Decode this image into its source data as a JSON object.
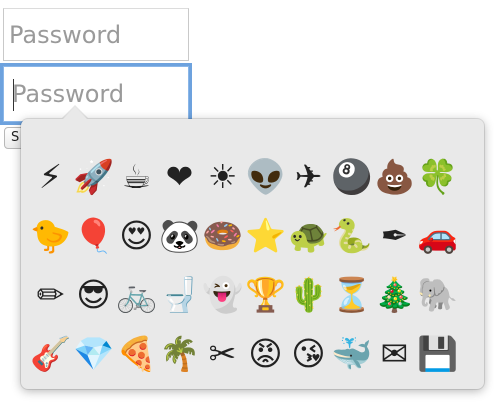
{
  "password_field_1": {
    "placeholder": "Password"
  },
  "password_field_2": {
    "placeholder": "Password"
  },
  "underlying_button": {
    "label": "S"
  },
  "emoji_picker": {
    "emojis": [
      {
        "char": "⚡",
        "name": "high-voltage"
      },
      {
        "char": "🚀",
        "name": "rocket"
      },
      {
        "char": "☕",
        "name": "hot-beverage"
      },
      {
        "char": "❤",
        "name": "black-heart"
      },
      {
        "char": "☀",
        "name": "sun"
      },
      {
        "char": "👽",
        "name": "alien"
      },
      {
        "char": "✈",
        "name": "airplane"
      },
      {
        "char": "🎱",
        "name": "pool-8-ball"
      },
      {
        "char": "💩",
        "name": "pile-of-poo"
      },
      {
        "char": "🍀",
        "name": "four-leaf-clover"
      },
      {
        "char": "🐤",
        "name": "baby-chick"
      },
      {
        "char": "🎈",
        "name": "balloon"
      },
      {
        "char": "😍",
        "name": "heart-eyes"
      },
      {
        "char": "🐼",
        "name": "panda"
      },
      {
        "char": "🍩",
        "name": "doughnut"
      },
      {
        "char": "⭐",
        "name": "star"
      },
      {
        "char": "🐢",
        "name": "turtle"
      },
      {
        "char": "🐍",
        "name": "snake"
      },
      {
        "char": "✒",
        "name": "black-nib"
      },
      {
        "char": "🚗",
        "name": "automobile"
      },
      {
        "char": "✏",
        "name": "pencil"
      },
      {
        "char": "😎",
        "name": "sunglasses-face"
      },
      {
        "char": "🚲",
        "name": "bicycle"
      },
      {
        "char": "🚽",
        "name": "toilet"
      },
      {
        "char": "👻",
        "name": "ghost"
      },
      {
        "char": "🏆",
        "name": "trophy"
      },
      {
        "char": "🌵",
        "name": "cactus"
      },
      {
        "char": "⏳",
        "name": "hourglass"
      },
      {
        "char": "🎄",
        "name": "christmas-tree"
      },
      {
        "char": "🐘",
        "name": "elephant"
      },
      {
        "char": "🎸",
        "name": "guitar"
      },
      {
        "char": "💎",
        "name": "gem"
      },
      {
        "char": "🍕",
        "name": "pizza"
      },
      {
        "char": "🌴",
        "name": "palm-tree"
      },
      {
        "char": "✂",
        "name": "scissors"
      },
      {
        "char": "😡",
        "name": "pouting-face"
      },
      {
        "char": "😘",
        "name": "face-blowing-kiss"
      },
      {
        "char": "🐳",
        "name": "spouting-whale"
      },
      {
        "char": "✉",
        "name": "envelope"
      },
      {
        "char": "💾",
        "name": "floppy-disk"
      }
    ]
  },
  "colors": {
    "focus_ring": "#6da2de",
    "picker_background": "#e9e9e9",
    "placeholder_text": "#9a9a9a"
  }
}
